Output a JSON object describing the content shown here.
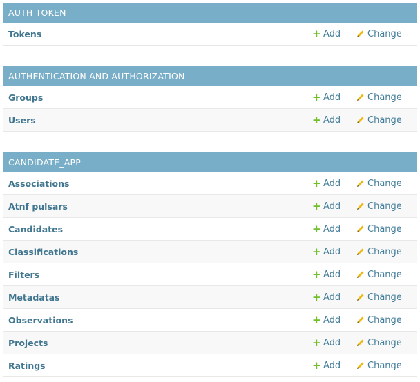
{
  "colors": {
    "caption_bg": "#79aec8",
    "link": "#417690",
    "add_icon": "#70bf2b",
    "change_icon": "#efb80b"
  },
  "icons": {
    "add": "plus-icon",
    "change": "pencil-icon"
  },
  "action_labels": {
    "add": "Add",
    "change": "Change"
  },
  "modules": [
    {
      "caption": "AUTH TOKEN",
      "models": [
        {
          "name": "Tokens"
        }
      ]
    },
    {
      "caption": "AUTHENTICATION AND AUTHORIZATION",
      "models": [
        {
          "name": "Groups"
        },
        {
          "name": "Users"
        }
      ]
    },
    {
      "caption": "CANDIDATE_APP",
      "models": [
        {
          "name": "Associations"
        },
        {
          "name": "Atnf pulsars"
        },
        {
          "name": "Candidates"
        },
        {
          "name": "Classifications"
        },
        {
          "name": "Filters"
        },
        {
          "name": "Metadatas"
        },
        {
          "name": "Observations"
        },
        {
          "name": "Projects"
        },
        {
          "name": "Ratings"
        }
      ]
    }
  ]
}
